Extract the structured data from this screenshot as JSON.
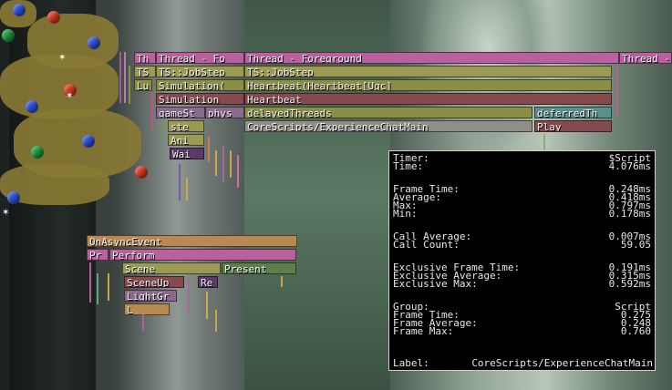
{
  "profiler": {
    "row1": {
      "a": "Th",
      "b": "Thread - Fo",
      "c": "Thread - Foreground",
      "d": "Thread -"
    },
    "row2": {
      "a": "TS",
      "b": "TS::JobStep",
      "c": "TS::JobStep"
    },
    "row3": {
      "a": "Lu",
      "b": "Simulation(",
      "c": "Heartbeat(Heartbeat[Ugc]"
    },
    "row4": {
      "b": "Simulation",
      "c": "Heartbeat"
    },
    "row5": {
      "b": "gameSt",
      "b2": "phys",
      "c": "delayedThreads",
      "d": "deferredTh"
    },
    "row6": {
      "b": "ste",
      "c": "CoreScripts/ExperienceChatMain",
      "d": "Play"
    },
    "row7": {
      "b": "Ani"
    },
    "row8": {
      "b": "Wai"
    },
    "lower": {
      "l1": "OnAsyncEvent",
      "l2a": "Pr",
      "l2b": "Perform",
      "l3a": "Scene",
      "l3b": "Present",
      "l4a": "SceneUp",
      "l4b": "Re",
      "l5": "LightGr",
      "l6": "L"
    }
  },
  "timer_panel": {
    "timer": {
      "k": "Timer:",
      "v": "$Script"
    },
    "time": {
      "k": "Time:",
      "v": "4.076ms"
    },
    "frame_time": {
      "k": "Frame Time:",
      "v": "0.248ms"
    },
    "average": {
      "k": "Average:",
      "v": "0.418ms"
    },
    "max": {
      "k": "Max:",
      "v": "0.797ms"
    },
    "min": {
      "k": "Min:",
      "v": "0.178ms"
    },
    "call_average": {
      "k": "Call Average:",
      "v": "0.007ms"
    },
    "call_count": {
      "k": "Call Count:",
      "v": "59.05"
    },
    "excl_frame_time": {
      "k": "Exclusive Frame Time:",
      "v": "0.191ms"
    },
    "excl_average": {
      "k": "Exclusive Average:",
      "v": "0.315ms"
    },
    "excl_max": {
      "k": "Exclusive Max:",
      "v": "0.592ms"
    },
    "group": {
      "k": "Group:",
      "v": "Script"
    },
    "g_frame_time": {
      "k": "Frame Time:",
      "v": "0.275"
    },
    "g_frame_average": {
      "k": "Frame Average:",
      "v": "0.248"
    },
    "g_frame_max": {
      "k": "Frame Max:",
      "v": "0.760"
    },
    "label": {
      "k": "Label:",
      "v": "CoreScripts/ExperienceChatMain"
    }
  }
}
